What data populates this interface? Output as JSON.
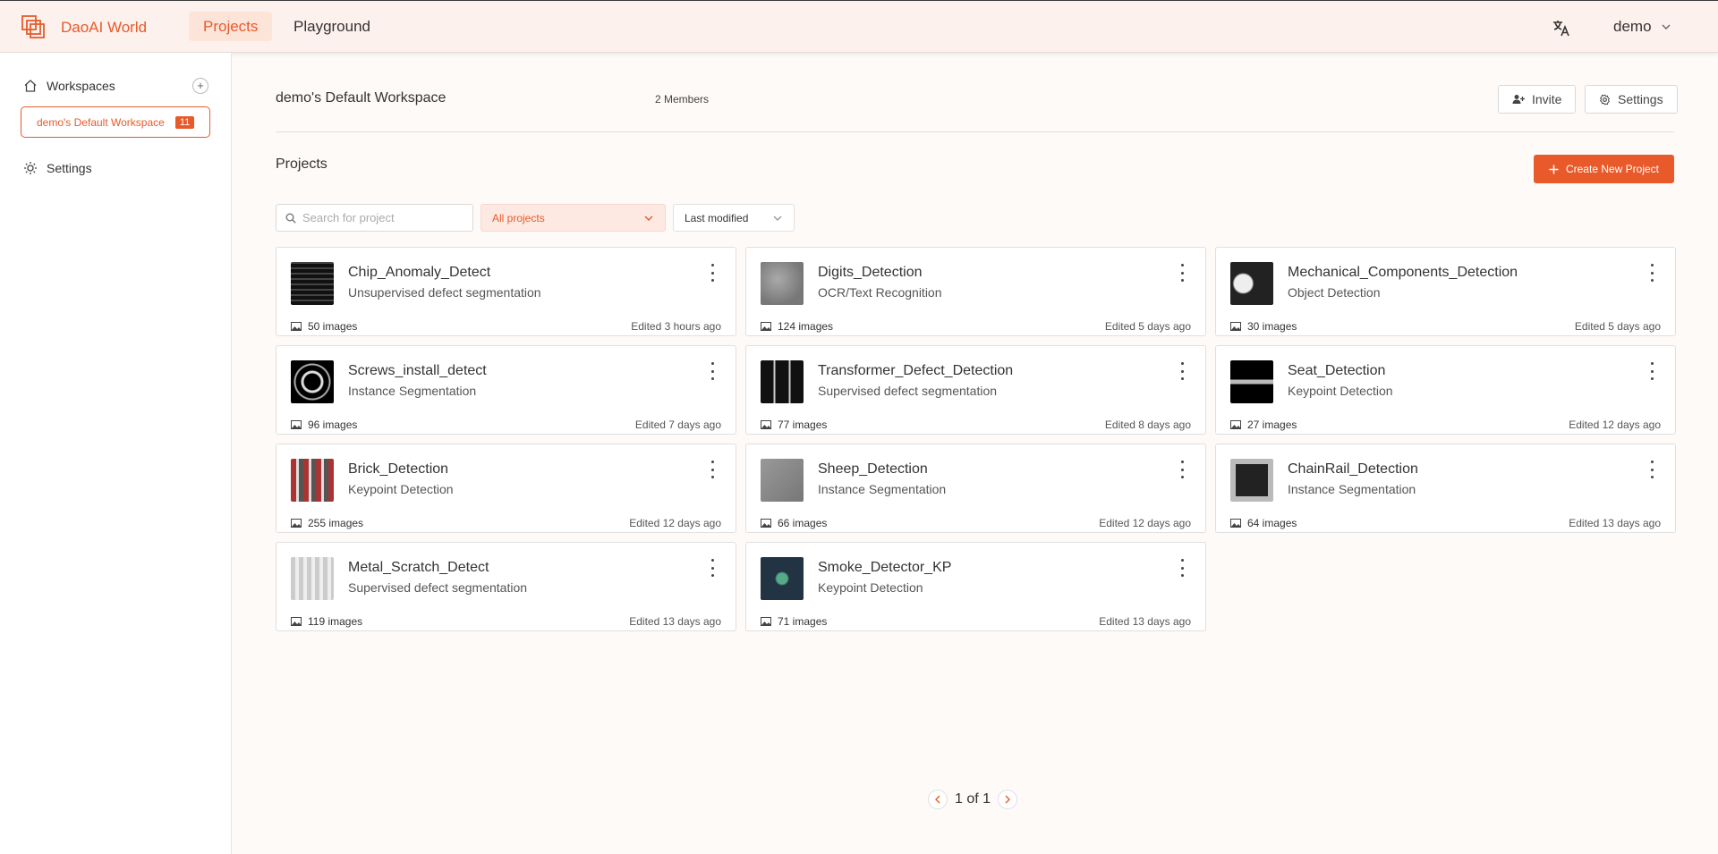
{
  "app": {
    "brand": "DaoAI World",
    "accent": "#e85a2a"
  },
  "nav": {
    "tabs": [
      {
        "label": "Projects",
        "active": true
      },
      {
        "label": "Playground",
        "active": false
      }
    ]
  },
  "user": {
    "name": "demo"
  },
  "sidebar": {
    "workspaces_label": "Workspaces",
    "active_workspace": {
      "label": "demo's Default Workspace",
      "count": "11"
    },
    "settings_label": "Settings"
  },
  "workspace": {
    "title": "demo's Default Workspace",
    "members": "2 Members",
    "invite_label": "Invite",
    "settings_label": "Settings"
  },
  "projects_section": {
    "title": "Projects",
    "create_label": "Create New Project",
    "search_placeholder": "Search for project",
    "filter_value": "All projects",
    "sort_value": "Last modified"
  },
  "projects": [
    {
      "name": "Chip_Anomaly_Detect",
      "type": "Unsupervised defect segmentation",
      "images": "50 images",
      "edited": "Edited 3 hours ago",
      "thumb_icon": "chip-thumbnail"
    },
    {
      "name": "Digits_Detection",
      "type": "OCR/Text Recognition",
      "images": "124 images",
      "edited": "Edited 5 days ago",
      "thumb_icon": "digits-thumbnail"
    },
    {
      "name": "Mechanical_Components_Detection",
      "type": "Object Detection",
      "images": "30 images",
      "edited": "Edited 5 days ago",
      "thumb_icon": "components-thumbnail"
    },
    {
      "name": "Screws_install_detect",
      "type": "Instance Segmentation",
      "images": "96 images",
      "edited": "Edited 7 days ago",
      "thumb_icon": "screws-thumbnail"
    },
    {
      "name": "Transformer_Defect_Detection",
      "type": "Supervised defect segmentation",
      "images": "77 images",
      "edited": "Edited 8 days ago",
      "thumb_icon": "transformer-thumbnail"
    },
    {
      "name": "Seat_Detection",
      "type": "Keypoint Detection",
      "images": "27 images",
      "edited": "Edited 12 days ago",
      "thumb_icon": "seat-thumbnail"
    },
    {
      "name": "Brick_Detection",
      "type": "Keypoint Detection",
      "images": "255 images",
      "edited": "Edited 12 days ago",
      "thumb_icon": "brick-thumbnail"
    },
    {
      "name": "Sheep_Detection",
      "type": "Instance Segmentation",
      "images": "66 images",
      "edited": "Edited 12 days ago",
      "thumb_icon": "sheep-thumbnail"
    },
    {
      "name": "ChainRail_Detection",
      "type": "Instance Segmentation",
      "images": "64 images",
      "edited": "Edited 13 days ago",
      "thumb_icon": "chainrail-thumbnail"
    },
    {
      "name": "Metal_Scratch_Detect",
      "type": "Supervised defect segmentation",
      "images": "119 images",
      "edited": "Edited 13 days ago",
      "thumb_icon": "metal-thumbnail"
    },
    {
      "name": "Smoke_Detector_KP",
      "type": "Keypoint Detection",
      "images": "71 images",
      "edited": "Edited 13 days ago",
      "thumb_icon": "smoke-thumbnail"
    }
  ],
  "pagination": {
    "text": "1 of 1"
  }
}
